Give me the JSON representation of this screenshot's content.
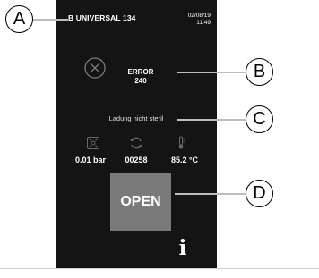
{
  "header": {
    "device_name": "B UNIVERSAL 134",
    "date": "02/08/19",
    "time": "11:49"
  },
  "error": {
    "icon": "error-x-circle-icon",
    "title": "ERROR",
    "code": "240"
  },
  "status_message": "Ladung nicht steril",
  "metrics": [
    {
      "icon": "pressure-icon",
      "value": "0.01 bar"
    },
    {
      "icon": "cycle-counter-icon",
      "value": "00258"
    },
    {
      "icon": "thermometer-icon",
      "value": "85.2 °C"
    }
  ],
  "open_button": {
    "label": "OPEN"
  },
  "info_button": {
    "label": "i",
    "icon": "info-icon"
  },
  "callouts": [
    "A",
    "B",
    "C",
    "D"
  ],
  "colors": {
    "screen_background": "#141414",
    "text": "#ffffff",
    "button_background": "#7a7a7a",
    "icon_dim": "#6a6a6a"
  }
}
